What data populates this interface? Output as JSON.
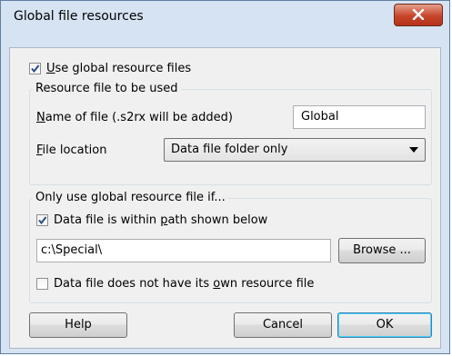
{
  "window": {
    "title": "Global file resources",
    "close_icon": "close-icon"
  },
  "use_global": {
    "checked": true,
    "label_pre": "",
    "label_mnemonic": "U",
    "label_post": "se global resource files"
  },
  "resource_group": {
    "legend": "Resource file to be used",
    "name_label_mnemonic": "N",
    "name_label_post": "ame of file (.s2rx will be added)",
    "name_value": "Global",
    "location_label_mnemonic": "F",
    "location_label_post": "ile location",
    "location_value": "Data file folder only"
  },
  "conditions_group": {
    "legend": "Only use global resource file if...",
    "within_path": {
      "checked": true,
      "label_pre": "Data file is within ",
      "label_mnemonic": "p",
      "label_post": "ath shown below"
    },
    "path_value": "c:\\Special\\",
    "browse_label": "Browse ...",
    "own_resource": {
      "checked": false,
      "label_pre": "Data file does not have its ",
      "label_mnemonic": "o",
      "label_post": "wn resource file"
    }
  },
  "buttons": {
    "help": "Help",
    "cancel": "Cancel",
    "ok": "OK"
  }
}
